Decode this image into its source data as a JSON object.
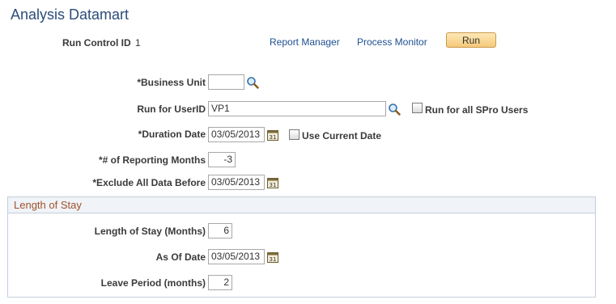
{
  "page": {
    "title": "Analysis Datamart"
  },
  "run_control": {
    "label": "Run Control ID",
    "value": "1"
  },
  "links": {
    "report_manager": "Report Manager",
    "process_monitor": "Process Monitor"
  },
  "run_button": {
    "label": "Run"
  },
  "fields": {
    "business_unit": {
      "label": "*Business Unit",
      "value": ""
    },
    "run_for_userid": {
      "label": "Run for UserID",
      "value": "VP1"
    },
    "run_for_all": {
      "label": "Run for all SPro Users",
      "checked": false
    },
    "duration_date": {
      "label": "*Duration Date",
      "value": "03/05/2013"
    },
    "use_current_date": {
      "label": "Use Current Date",
      "checked": false
    },
    "reporting_months": {
      "label": "*# of Reporting Months",
      "value": "-3"
    },
    "exclude_before": {
      "label": "*Exclude All Data Before",
      "value": "03/05/2013"
    }
  },
  "length_of_stay_section": {
    "title": "Length of Stay",
    "length_of_stay": {
      "label": "Length of Stay (Months)",
      "value": "6"
    },
    "as_of_date": {
      "label": "As Of Date",
      "value": "03/05/2013"
    },
    "leave_period": {
      "label": "Leave Period (months)",
      "value": "2"
    }
  },
  "icons": {
    "lookup": "magnifier-icon",
    "calendar": "calendar-icon"
  },
  "colors": {
    "title": "#2b4c7a",
    "link": "#1d4f91",
    "section_title": "#a0522d",
    "button": "#f6c97a"
  }
}
